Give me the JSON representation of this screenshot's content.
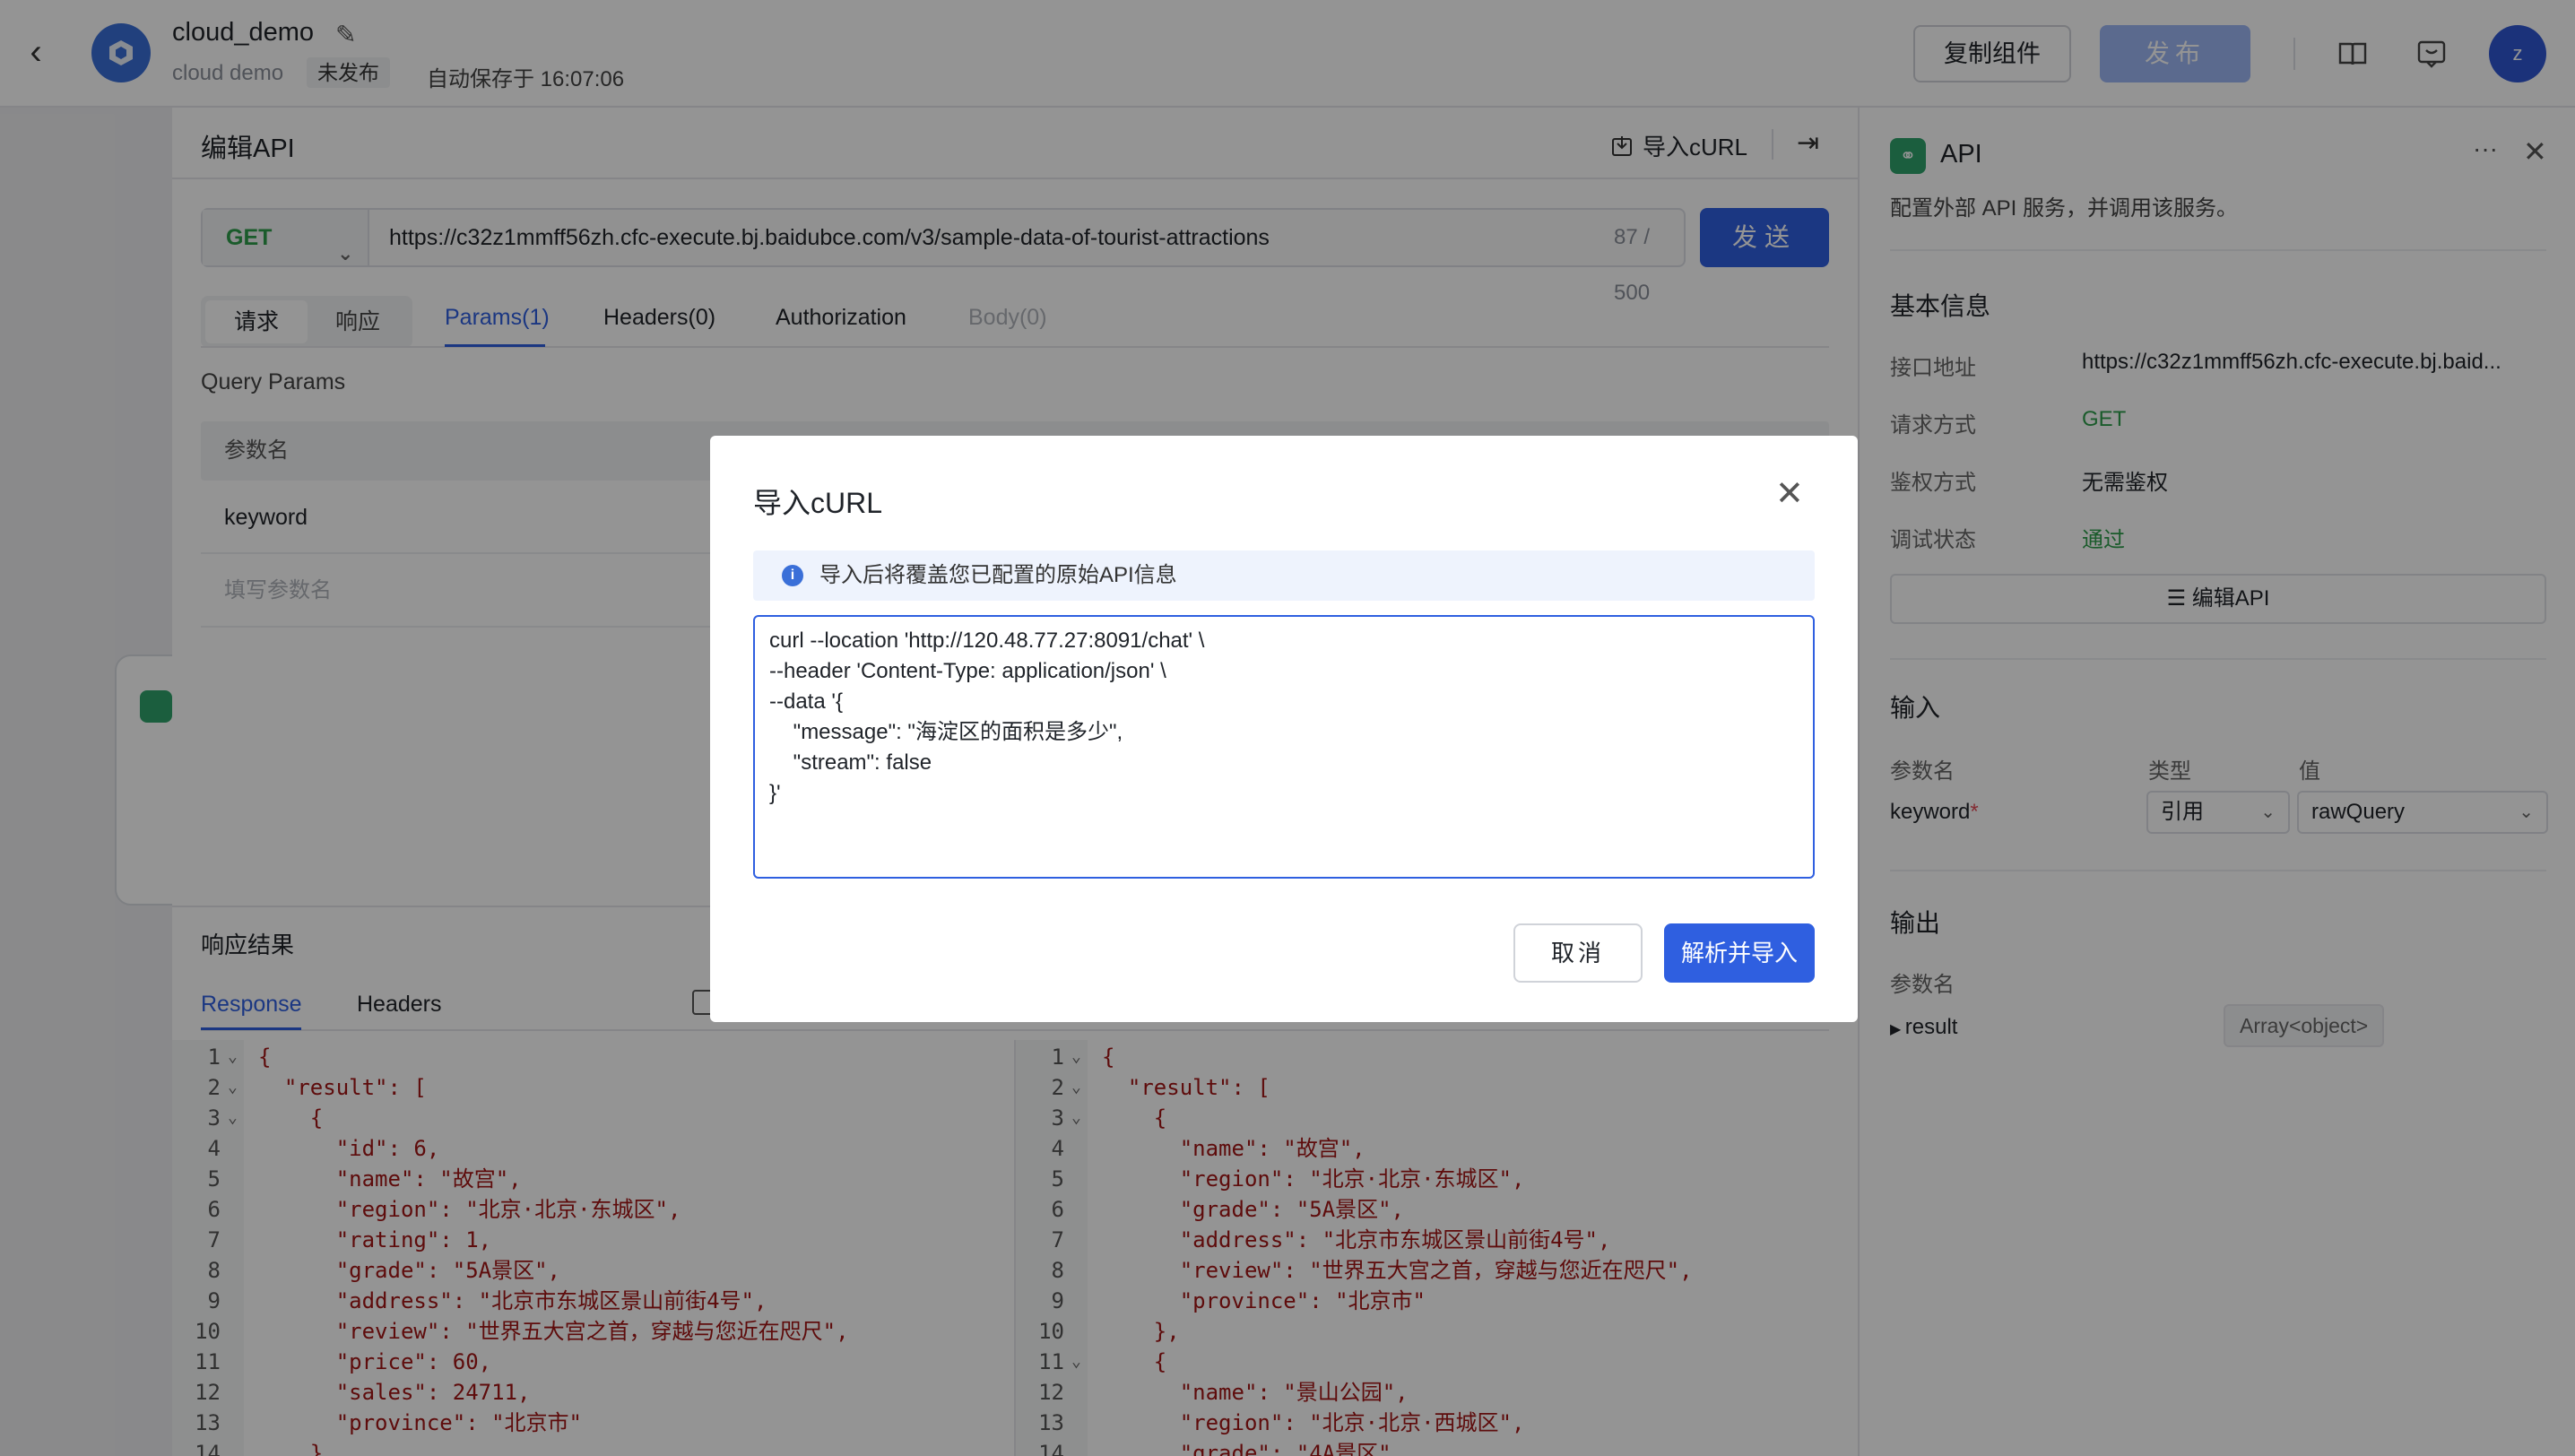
{
  "header": {
    "title": "cloud_demo",
    "subtitle": "cloud demo",
    "status_badge": "未发布",
    "autosave": "自动保存于 16:07:06",
    "copy_button": "复制组件",
    "publish_button": "发布",
    "avatar_letter": "z"
  },
  "edit_panel": {
    "title": "编辑API",
    "import_curl": "导入cURL",
    "method": "GET",
    "url": "https://c32z1mmff56zh.cfc-execute.bj.baidubce.com/v3/sample-data-of-tourist-attractions",
    "url_count": "87 / 500",
    "send_button": "发送",
    "segment": [
      "请求",
      "响应"
    ],
    "tabs": [
      "Params(1)",
      "Headers(0)",
      "Authorization",
      "Body(0)"
    ],
    "query_params_title": "Query Params",
    "param_name_header": "参数名",
    "param_key": "keyword",
    "param_placeholder": "填写参数名",
    "response_title": "响应结果",
    "response_tabs": [
      "Response",
      "Headers"
    ]
  },
  "code_left": [
    {
      "n": "1",
      "fold": true,
      "t": "{"
    },
    {
      "n": "2",
      "fold": true,
      "t": "  \"result\": ["
    },
    {
      "n": "3",
      "fold": true,
      "t": "    {"
    },
    {
      "n": "4",
      "fold": false,
      "t": "      \"id\": 6,"
    },
    {
      "n": "5",
      "fold": false,
      "t": "      \"name\": \"故宫\","
    },
    {
      "n": "6",
      "fold": false,
      "t": "      \"region\": \"北京·北京·东城区\","
    },
    {
      "n": "7",
      "fold": false,
      "t": "      \"rating\": 1,"
    },
    {
      "n": "8",
      "fold": false,
      "t": "      \"grade\": \"5A景区\","
    },
    {
      "n": "9",
      "fold": false,
      "t": "      \"address\": \"北京市东城区景山前街4号\","
    },
    {
      "n": "10",
      "fold": false,
      "t": "      \"review\": \"世界五大宫之首，穿越与您近在咫尺\","
    },
    {
      "n": "11",
      "fold": false,
      "t": "      \"price\": 60,"
    },
    {
      "n": "12",
      "fold": false,
      "t": "      \"sales\": 24711,"
    },
    {
      "n": "13",
      "fold": false,
      "t": "      \"province\": \"北京市\""
    },
    {
      "n": "14",
      "fold": false,
      "t": "    },"
    }
  ],
  "code_right": [
    {
      "n": "1",
      "fold": true,
      "t": "{"
    },
    {
      "n": "2",
      "fold": true,
      "t": "  \"result\": ["
    },
    {
      "n": "3",
      "fold": true,
      "t": "    {"
    },
    {
      "n": "4",
      "fold": false,
      "t": "      \"name\": \"故宫\","
    },
    {
      "n": "5",
      "fold": false,
      "t": "      \"region\": \"北京·北京·东城区\","
    },
    {
      "n": "6",
      "fold": false,
      "t": "      \"grade\": \"5A景区\","
    },
    {
      "n": "7",
      "fold": false,
      "t": "      \"address\": \"北京市东城区景山前街4号\","
    },
    {
      "n": "8",
      "fold": false,
      "t": "      \"review\": \"世界五大宫之首，穿越与您近在咫尺\","
    },
    {
      "n": "9",
      "fold": false,
      "t": "      \"province\": \"北京市\""
    },
    {
      "n": "10",
      "fold": false,
      "t": "    },"
    },
    {
      "n": "11",
      "fold": true,
      "t": "    {"
    },
    {
      "n": "12",
      "fold": false,
      "t": "      \"name\": \"景山公园\","
    },
    {
      "n": "13",
      "fold": false,
      "t": "      \"region\": \"北京·北京·西城区\","
    },
    {
      "n": "14",
      "fold": false,
      "t": "      \"grade\": \"4A景区\","
    }
  ],
  "right_panel": {
    "title": "API",
    "more": "···",
    "description": "配置外部 API 服务，并调用该服务。",
    "basic_info_title": "基本信息",
    "endpoint_label": "接口地址",
    "endpoint_value": "https://c32z1mmff56zh.cfc-execute.bj.baid...",
    "method_label": "请求方式",
    "method_value": "GET",
    "auth_label": "鉴权方式",
    "auth_value": "无需鉴权",
    "debug_label": "调试状态",
    "debug_value": "通过",
    "edit_api_button": "编辑API",
    "input_title": "输入",
    "col_param": "参数名",
    "col_type": "类型",
    "col_value": "值",
    "input_param": "keyword",
    "required_mark": "*",
    "input_type": "引用",
    "input_value": "rawQuery",
    "output_title": "输出",
    "output_col_param": "参数名",
    "output_param": "result",
    "output_type": "Array<object>"
  },
  "modal": {
    "title": "导入cURL",
    "alert": "导入后将覆盖您已配置的原始API信息",
    "curl_text": "curl --location 'http://120.48.77.27:8091/chat' \\\n--header 'Content-Type: application/json' \\\n--data '{\n    \"message\": \"海淀区的面积是多少\",\n    \"stream\": false\n}'",
    "cancel_button": "取消",
    "confirm_button": "解析并导入"
  },
  "colors": {
    "primary": "#2f5fe0",
    "success": "#2d9d4b",
    "publish_disabled": "#9db7f5"
  }
}
